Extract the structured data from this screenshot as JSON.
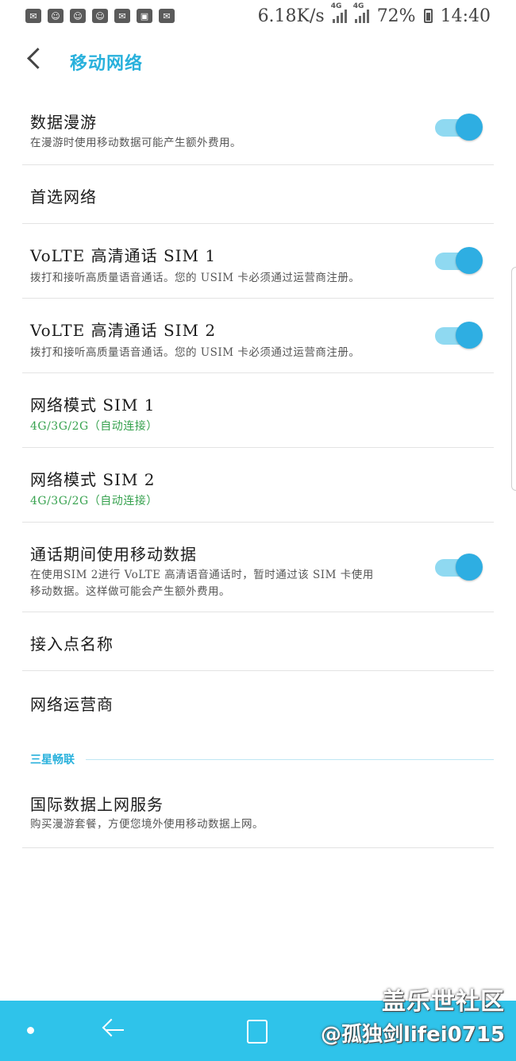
{
  "status_bar": {
    "speed": "6.18K/s",
    "network1": "4G",
    "network2": "4G",
    "battery": "72%",
    "time": "14:40"
  },
  "app_bar": {
    "title": "移动网络"
  },
  "items": [
    {
      "title": "数据漫游",
      "subtitle": "在漫游时使用移动数据可能产生额外费用。",
      "toggle_on": true
    },
    {
      "title": "首选网络"
    },
    {
      "title": "VoLTE 高清通话 SIM 1",
      "subtitle": "拨打和接听高质量语音通话。您的 USIM 卡必须通过运营商注册。",
      "toggle_on": true
    },
    {
      "title": "VoLTE 高清通话 SIM 2",
      "subtitle": "拨打和接听高质量语音通话。您的 USIM 卡必须通过运营商注册。",
      "toggle_on": true
    },
    {
      "title": "网络模式 SIM 1",
      "value": "4G/3G/2G（自动连接）"
    },
    {
      "title": "网络模式 SIM 2",
      "value": "4G/3G/2G（自动连接）"
    },
    {
      "title": "通话期间使用移动数据",
      "subtitle_line1": "在使用SIM 2进行 VoLTE 高清语音通话时，暂时通过该 SIM 卡使用",
      "subtitle_line2": "移动数据。这样做可能会产生额外费用。",
      "toggle_on": true
    },
    {
      "title": "接入点名称"
    },
    {
      "title": "网络运营商"
    }
  ],
  "section": {
    "header": "三星畅联",
    "item": {
      "title": "国际数据上网服务",
      "subtitle": "购买漫游套餐，方便您境外使用移动数据上网。"
    }
  },
  "watermark": {
    "line1": "盖乐世社区",
    "line2": "@孤独剑lifei0715"
  },
  "colors": {
    "accent": "#29b1dc",
    "toggle_track": "#8fd9f1",
    "toggle_knob": "#2eaee2",
    "value_green": "#37a24f",
    "navbar": "#2fc3ea"
  }
}
